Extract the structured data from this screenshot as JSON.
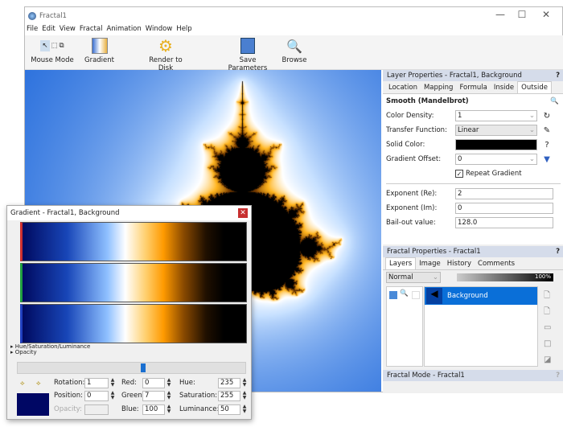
{
  "window": {
    "title": "Fractal1",
    "controls": [
      "—",
      "☐",
      "✕"
    ]
  },
  "menu": [
    "File",
    "Edit",
    "View",
    "Fractal",
    "Animation",
    "Window",
    "Help"
  ],
  "toolbar": {
    "mouse_mode": "Mouse Mode",
    "gradient": "Gradient",
    "render": "Render to Disk",
    "save": "Save Parameters",
    "browse": "Browse"
  },
  "layer_props": {
    "header": "Layer Properties - Fractal1, Background",
    "help": "?",
    "tabs": [
      "Location",
      "Mapping",
      "Formula",
      "Inside",
      "Outside"
    ],
    "active_tab": "Outside",
    "formula": "Smooth (Mandelbrot)",
    "color_density_label": "Color Density:",
    "color_density": "1",
    "transfer_label": "Transfer Function:",
    "transfer": "Linear",
    "solid_color_label": "Solid Color:",
    "solid_color": "#000000",
    "offset_label": "Gradient Offset:",
    "offset": "0",
    "repeat_label": "Repeat Gradient",
    "repeat_checked": true,
    "exp_re_label": "Exponent (Re):",
    "exp_re": "2",
    "exp_im_label": "Exponent (Im):",
    "exp_im": "0",
    "bailout_label": "Bail-out value:",
    "bailout": "128.0"
  },
  "fractal_props": {
    "header": "Fractal Properties - Fractal1",
    "help": "?",
    "tabs": [
      "Layers",
      "Image",
      "History",
      "Comments"
    ],
    "active_tab": "Layers",
    "blend_mode": "Normal",
    "opacity": "100%",
    "layer": "Background"
  },
  "fractal_mode": {
    "header": "Fractal Mode - Fractal1",
    "help": "?"
  },
  "gradient": {
    "title": "Gradient - Fractal1, Background",
    "sections": [
      "Hue/Saturation/Luminance",
      "Opacity"
    ],
    "slider_position": 0.55,
    "rotation_label": "Rotation:",
    "rotation": "1",
    "position_label": "Position:",
    "position": "0",
    "opacity_label": "Opacity:",
    "red_label": "Red:",
    "red": "0",
    "green_label": "Green:",
    "green": "7",
    "blue_label": "Blue:",
    "blue": "100",
    "hue_label": "Hue:",
    "hue": "235",
    "sat_label": "Saturation:",
    "sat": "255",
    "lum_label": "Luminance:",
    "lum": "50",
    "swatch": "#000764"
  }
}
